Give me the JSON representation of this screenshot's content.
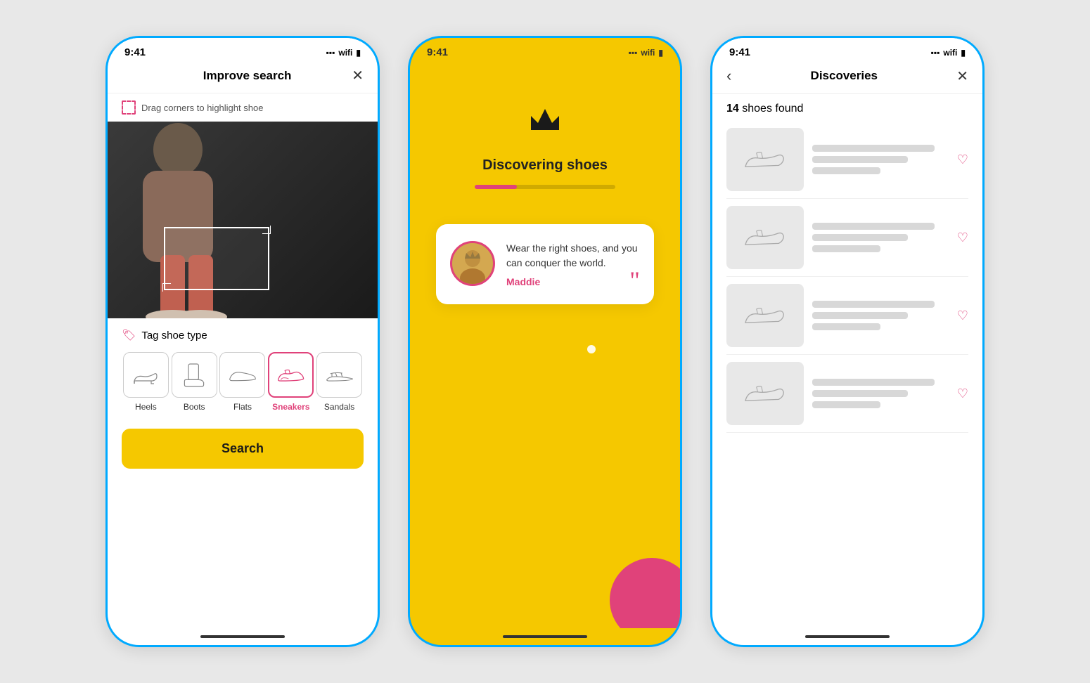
{
  "phone1": {
    "status_time": "9:41",
    "title": "Improve search",
    "close_label": "✕",
    "drag_hint": "Drag corners to highlight shoe",
    "tag_title": "Tag shoe type",
    "shoe_types": [
      {
        "id": "heels",
        "label": "Heels",
        "selected": false
      },
      {
        "id": "boots",
        "label": "Boots",
        "selected": false
      },
      {
        "id": "flats",
        "label": "Flats",
        "selected": false
      },
      {
        "id": "sneakers",
        "label": "Sneakers",
        "selected": true
      },
      {
        "id": "sandals",
        "label": "Sandals",
        "selected": false
      }
    ],
    "search_label": "Search"
  },
  "phone2": {
    "status_time": "9:41",
    "discovering_text": "Discovering shoes",
    "progress_percent": 30,
    "quote_text": "Wear the right shoes, and you can conquer the world.",
    "quote_author": "Maddie"
  },
  "phone3": {
    "status_time": "9:41",
    "title": "Discoveries",
    "back_label": "<",
    "close_label": "✕",
    "found_count": "14",
    "found_label": "shoes found",
    "results": [
      {
        "id": 1
      },
      {
        "id": 2
      },
      {
        "id": 3
      },
      {
        "id": 4
      }
    ]
  },
  "colors": {
    "brand_yellow": "#f5c800",
    "brand_pink": "#e0427a",
    "phone_border": "#00aaff"
  }
}
